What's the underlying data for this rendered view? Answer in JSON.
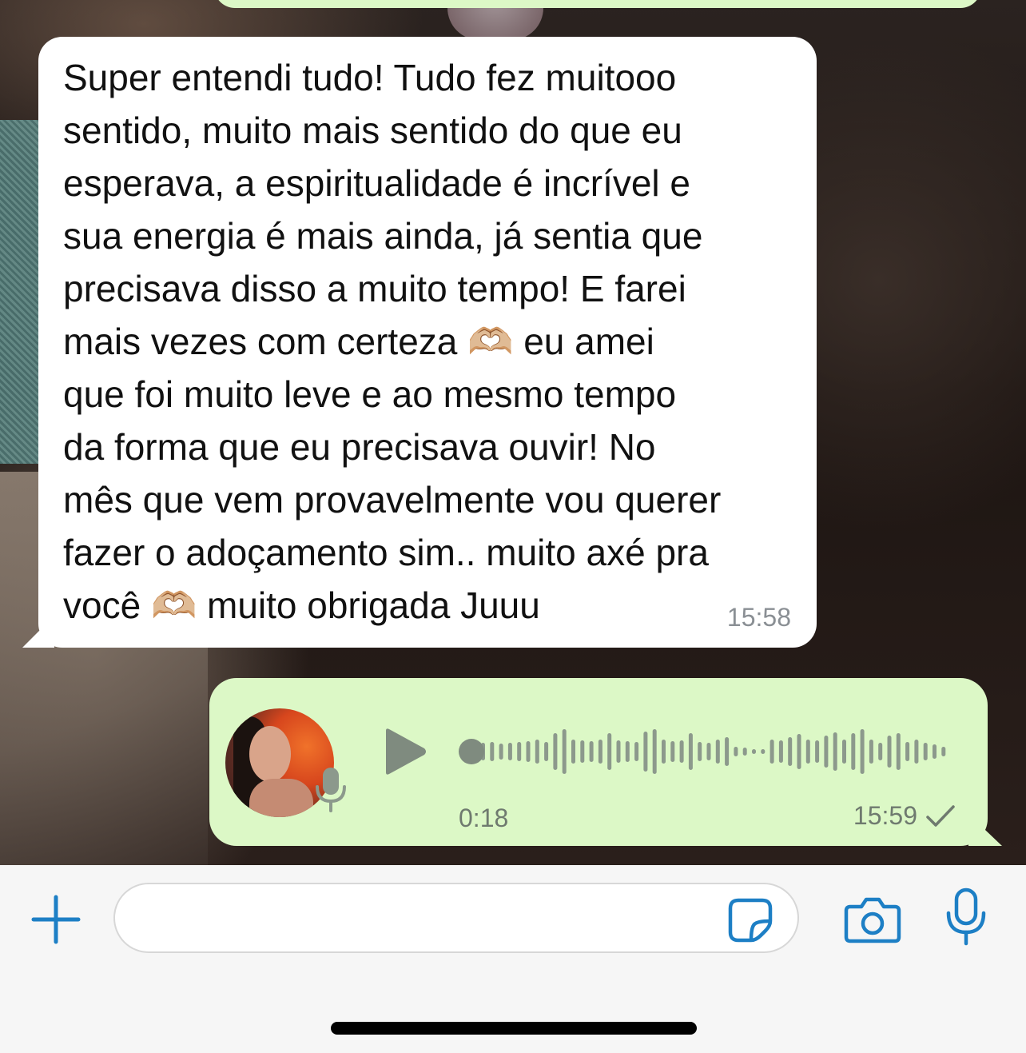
{
  "chat": {
    "incoming_message": {
      "text": "Super entendi tudo! Tudo fez muitooo\nsentido, muito mais sentido do que eu\nesperava, a espiritualidade é incrível e\nsua energia é mais ainda, já sentia que\nprecisava disso a muito tempo! E farei\nmais vezes com certeza 🫶🏼 eu amei\nque foi muito leve e ao mesmo tempo\nda forma que eu precisava ouvir! No\nmês que vem provavelmente vou querer\nfazer o adoçamento sim.. muito axé pra\nvocê 🫶🏼 muito obrigada Juuu",
      "time": "15:58"
    },
    "voice_message": {
      "duration": "0:18",
      "time": "15:59",
      "status_icon": "single-check-icon",
      "progress": 0
    }
  },
  "composer": {
    "placeholder": "",
    "plus_icon": "plus-icon",
    "sticker_icon": "sticker-icon",
    "camera_icon": "camera-icon",
    "mic_icon": "microphone-icon"
  },
  "colors": {
    "incoming_bubble": "#ffffff",
    "outgoing_bubble": "#dcf8c6",
    "accent_blue": "#1d7fc5",
    "waveform": "#8c998c",
    "timestamp": "#8a8f94"
  }
}
